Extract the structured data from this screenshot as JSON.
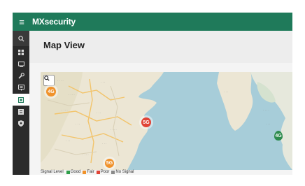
{
  "app": {
    "brand": "MXsecurity",
    "accent_color": "#1f7a5a"
  },
  "topbar": {
    "menu_icon": "hamburger-icon"
  },
  "sidebar": {
    "search_icon": "search-icon",
    "items": [
      {
        "icon": "dashboard-icon",
        "active": false
      },
      {
        "icon": "monitor-icon",
        "active": false
      },
      {
        "icon": "wrench-icon",
        "active": false
      },
      {
        "icon": "devices-icon",
        "active": false
      },
      {
        "icon": "map-icon",
        "active": true
      },
      {
        "icon": "report-icon",
        "active": false
      },
      {
        "icon": "shield-icon",
        "active": false
      }
    ]
  },
  "main": {
    "page_title": "Map View"
  },
  "map": {
    "zoom_icon": "magnifier-icon",
    "markers": [
      {
        "label": "4G",
        "color": "#f0922b"
      },
      {
        "label": "5G",
        "color": "#e04437"
      },
      {
        "label": "5G",
        "color": "#f0922b"
      },
      {
        "label": "4G",
        "color": "#2e8b4e"
      }
    ]
  },
  "legend": {
    "title": "Signal Level",
    "items": [
      {
        "label": "Good",
        "color": "#2e9e4a"
      },
      {
        "label": "Fair",
        "color": "#f0922b"
      },
      {
        "label": "Poor",
        "color": "#e04437"
      },
      {
        "label": "No Signal",
        "color": "#8a8a8a"
      }
    ]
  }
}
